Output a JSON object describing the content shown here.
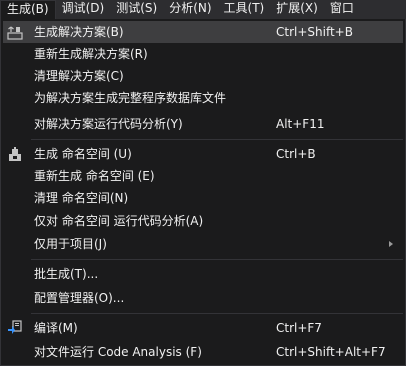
{
  "menubar": {
    "items": [
      "生成(B)",
      "调试(D)",
      "测试(S)",
      "分析(N)",
      "工具(T)",
      "扩展(X)",
      "窗口"
    ]
  },
  "build_menu": {
    "items": [
      {
        "label": "生成解决方案(B)",
        "shortcut": "Ctrl+Shift+B",
        "icon": "build-solution-icon"
      },
      {
        "label": "重新生成解决方案(R)",
        "shortcut": ""
      },
      {
        "label": "清理解决方案(C)",
        "shortcut": ""
      },
      {
        "label": "为解决方案生成完整程序数据库文件",
        "shortcut": ""
      },
      {
        "label": "对解决方案运行代码分析(Y)",
        "shortcut": "Alt+F11"
      },
      {
        "label": "生成 命名空间 (U)",
        "shortcut": "Ctrl+B",
        "icon": "build-project-icon"
      },
      {
        "label": "重新生成 命名空间 (E)",
        "shortcut": ""
      },
      {
        "label": "清理 命名空间(N)",
        "shortcut": ""
      },
      {
        "label": "仅对 命名空间 运行代码分析(A)",
        "shortcut": ""
      },
      {
        "label": "仅用于项目(J)",
        "shortcut": "",
        "submenu": true
      },
      {
        "label": "批生成(T)...",
        "shortcut": ""
      },
      {
        "label": "配置管理器(O)...",
        "shortcut": ""
      },
      {
        "label": "编译(M)",
        "shortcut": "Ctrl+F7",
        "icon": "compile-icon"
      },
      {
        "label": "对文件运行 Code Analysis (F)",
        "shortcut": "Ctrl+Shift+Alt+F7"
      }
    ]
  },
  "colors": {
    "menubar_bg": "#2d2d30",
    "menu_bg": "#1b1b1c",
    "highlight_bg": "#3e3e40",
    "text": "#f1f1f1",
    "separator": "#333337"
  }
}
